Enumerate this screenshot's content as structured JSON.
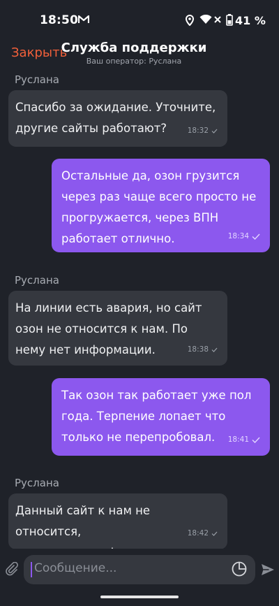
{
  "status": {
    "time": "18:50",
    "battery": "41 %"
  },
  "header": {
    "close_label": "Закрыть",
    "title": "Служба поддержки",
    "subtitle": "Ваш оператор: Руслана"
  },
  "messages": [
    {
      "sender": "Руслана",
      "direction": "in",
      "lines": [
        "Спасибо за ожидание. Уточните,",
        "другие сайты работают?"
      ],
      "time": "18:32"
    },
    {
      "direction": "out",
      "lines": [
        "Остальные да, озон грузится",
        "через раз чаще всего просто не",
        "прогружается, через ВПН",
        "работает отлично."
      ],
      "time": "18:34"
    },
    {
      "sender": "Руслана",
      "direction": "in",
      "lines": [
        "На линии есть авария, но сайт",
        "озон не относится к нам. По",
        "нему нет информации."
      ],
      "time": "18:38"
    },
    {
      "direction": "out",
      "lines": [
        "Так озон так работает уже пол",
        "года. Терпение лопает что",
        "только не перепробовал."
      ],
      "time": "18:41"
    },
    {
      "sender": "Руслана",
      "direction": "in",
      "lines": [
        "Данный сайт к нам не относится,",
        "по нему нет информации у нас."
      ],
      "time": "18:42"
    }
  ],
  "input": {
    "placeholder": "Сообщение..."
  },
  "colors": {
    "accent": "#8c58ee",
    "close": "#f2603a",
    "background": "#1f2229",
    "bubble_in": "#35383f"
  }
}
